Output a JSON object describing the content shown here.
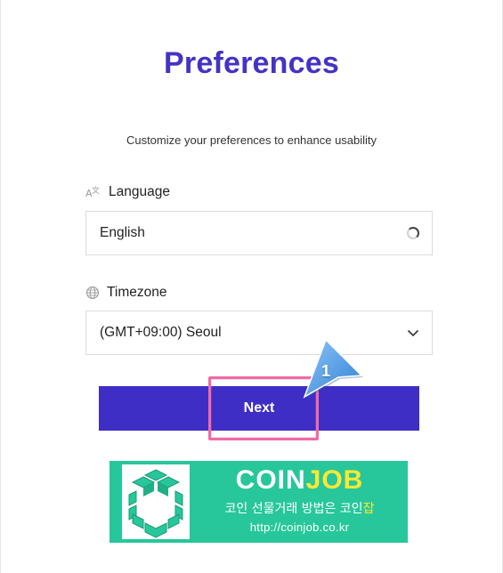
{
  "page": {
    "title": "Preferences",
    "subtitle": "Customize your preferences to enhance usability"
  },
  "language": {
    "label": "Language",
    "icon": "translate-icon",
    "value": "English",
    "state": "loading"
  },
  "timezone": {
    "label": "Timezone",
    "icon": "globe-icon",
    "value": "(GMT+09:00) Seoul"
  },
  "next_button": {
    "label": "Next"
  },
  "annotation": {
    "step_number": "1",
    "highlight_color": "#f06aa6",
    "marker_color": "#3d8fe0"
  },
  "banner": {
    "brand_part1": "COIN",
    "brand_part2": "JOB",
    "tagline_main": "코인 선물거래 방법은 코인",
    "tagline_highlight": "잡",
    "url": "http://coinjob.co.kr",
    "background": "#27c79b",
    "accent": "#ffe832"
  },
  "colors": {
    "primary": "#3f2ec6",
    "title": "#4433c4",
    "border": "#dcdcdc"
  }
}
